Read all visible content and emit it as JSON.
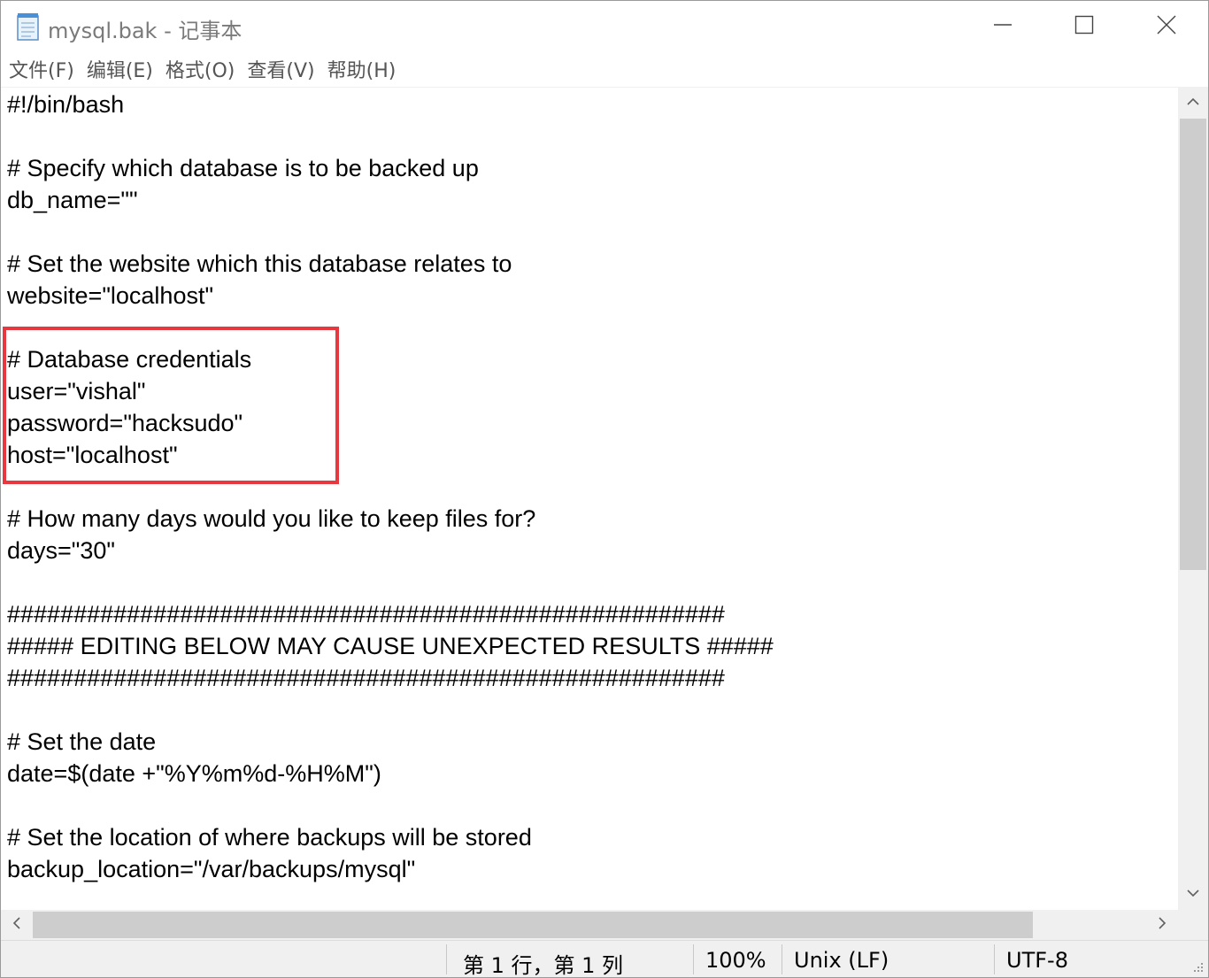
{
  "window": {
    "title": "mysql.bak - 记事本",
    "icons": {
      "app": "notepad-icon",
      "minimize": "minimize-icon",
      "maximize": "maximize-icon",
      "close": "close-icon"
    }
  },
  "menu": {
    "items": [
      "文件(F)",
      "编辑(E)",
      "格式(O)",
      "查看(V)",
      "帮助(H)"
    ]
  },
  "editor": {
    "lines": [
      "#!/bin/bash",
      "",
      "# Specify which database is to be backed up",
      "db_name=\"\"",
      "",
      "# Set the website which this database relates to",
      "website=\"localhost\"",
      "",
      "# Database credentials",
      "user=\"vishal\"",
      "password=\"hacksudo\"",
      "host=\"localhost\"",
      "",
      "# How many days would you like to keep files for?",
      "days=\"30\"",
      "",
      "######################################################",
      "##### EDITING BELOW MAY CAUSE UNEXPECTED RESULTS #####",
      "######################################################",
      "",
      "# Set the date",
      "date=$(date +\"%Y%m%d-%H%M\")",
      "",
      "# Set the location of where backups will be stored",
      "backup_location=\"/var/backups/mysql\""
    ],
    "highlight_color": "#e8383f"
  },
  "statusbar": {
    "position": "第 1 行，第 1 列",
    "zoom": "100%",
    "line_ending": "Unix (LF)",
    "encoding": "UTF-8"
  }
}
